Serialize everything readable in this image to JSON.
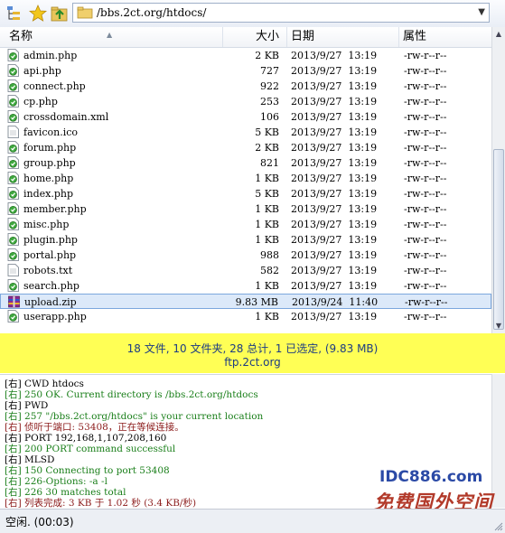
{
  "toolbar": {
    "address": "/bbs.2ct.org/htdocs/",
    "icons": [
      "tree-view-icon",
      "star-icon",
      "up-folder-icon"
    ]
  },
  "columns": {
    "name": "名称",
    "size": "大小",
    "date": "日期",
    "attr": "属性"
  },
  "files": [
    {
      "name": "admin.php",
      "size": "2 KB",
      "date": "2013/9/27  13:19",
      "attr": "-rw-r--r--",
      "type": "php"
    },
    {
      "name": "api.php",
      "size": "727",
      "date": "2013/9/27  13:19",
      "attr": "-rw-r--r--",
      "type": "php"
    },
    {
      "name": "connect.php",
      "size": "922",
      "date": "2013/9/27  13:19",
      "attr": "-rw-r--r--",
      "type": "php"
    },
    {
      "name": "cp.php",
      "size": "253",
      "date": "2013/9/27  13:19",
      "attr": "-rw-r--r--",
      "type": "php"
    },
    {
      "name": "crossdomain.xml",
      "size": "106",
      "date": "2013/9/27  13:19",
      "attr": "-rw-r--r--",
      "type": "xml"
    },
    {
      "name": "favicon.ico",
      "size": "5 KB",
      "date": "2013/9/27  13:19",
      "attr": "-rw-r--r--",
      "type": "doc"
    },
    {
      "name": "forum.php",
      "size": "2 KB",
      "date": "2013/9/27  13:19",
      "attr": "-rw-r--r--",
      "type": "php"
    },
    {
      "name": "group.php",
      "size": "821",
      "date": "2013/9/27  13:19",
      "attr": "-rw-r--r--",
      "type": "php"
    },
    {
      "name": "home.php",
      "size": "1 KB",
      "date": "2013/9/27  13:19",
      "attr": "-rw-r--r--",
      "type": "php"
    },
    {
      "name": "index.php",
      "size": "5 KB",
      "date": "2013/9/27  13:19",
      "attr": "-rw-r--r--",
      "type": "php"
    },
    {
      "name": "member.php",
      "size": "1 KB",
      "date": "2013/9/27  13:19",
      "attr": "-rw-r--r--",
      "type": "php"
    },
    {
      "name": "misc.php",
      "size": "1 KB",
      "date": "2013/9/27  13:19",
      "attr": "-rw-r--r--",
      "type": "php"
    },
    {
      "name": "plugin.php",
      "size": "1 KB",
      "date": "2013/9/27  13:19",
      "attr": "-rw-r--r--",
      "type": "php"
    },
    {
      "name": "portal.php",
      "size": "988",
      "date": "2013/9/27  13:19",
      "attr": "-rw-r--r--",
      "type": "php"
    },
    {
      "name": "robots.txt",
      "size": "582",
      "date": "2013/9/27  13:19",
      "attr": "-rw-r--r--",
      "type": "doc"
    },
    {
      "name": "search.php",
      "size": "1 KB",
      "date": "2013/9/27  13:19",
      "attr": "-rw-r--r--",
      "type": "php"
    },
    {
      "name": "upload.zip",
      "size": "9.83 MB",
      "date": "2013/9/24  11:40",
      "attr": "-rw-r--r--",
      "type": "zip",
      "selected": true
    },
    {
      "name": "userapp.php",
      "size": "1 KB",
      "date": "2013/9/27  13:19",
      "attr": "-rw-r--r--",
      "type": "php"
    }
  ],
  "summary": {
    "line1": "18 文件, 10 文件夹, 28 总计, 1 已选定, (9.83 MB)",
    "line2": "ftp.2ct.org"
  },
  "log": [
    {
      "text": "[右] CWD htdocs",
      "kind": "cmd"
    },
    {
      "text": "[右] 250 OK. Current directory is /bbs.2ct.org/htdocs",
      "kind": "ok"
    },
    {
      "text": "[右] PWD",
      "kind": "cmd"
    },
    {
      "text": "[右] 257 \"/bbs.2ct.org/htdocs\" is your current location",
      "kind": "ok"
    },
    {
      "text": "[右] 侦听于端口: 53408，正在等候连接。",
      "kind": "info"
    },
    {
      "text": "[右] PORT 192,168,1,107,208,160",
      "kind": "cmd"
    },
    {
      "text": "[右] 200 PORT command successful",
      "kind": "ok"
    },
    {
      "text": "[右] MLSD",
      "kind": "cmd"
    },
    {
      "text": "[右] 150 Connecting to port 53408",
      "kind": "ok"
    },
    {
      "text": "[右] 226-Options: -a -l",
      "kind": "ok"
    },
    {
      "text": "[右] 226 30 matches total",
      "kind": "ok"
    },
    {
      "text": "[右] 列表完成: 3 KB 于 1.02 秒 (3.4 KB/秒)",
      "kind": "info"
    }
  ],
  "log_colors": {
    "cmd": "#000000",
    "ok": "#1a7f1a",
    "info": "#8b1a1a"
  },
  "watermark": {
    "line1": "IDC886.com",
    "line2": "免费国外空间"
  },
  "statusbar": {
    "text": "空闲. (00:03)"
  }
}
